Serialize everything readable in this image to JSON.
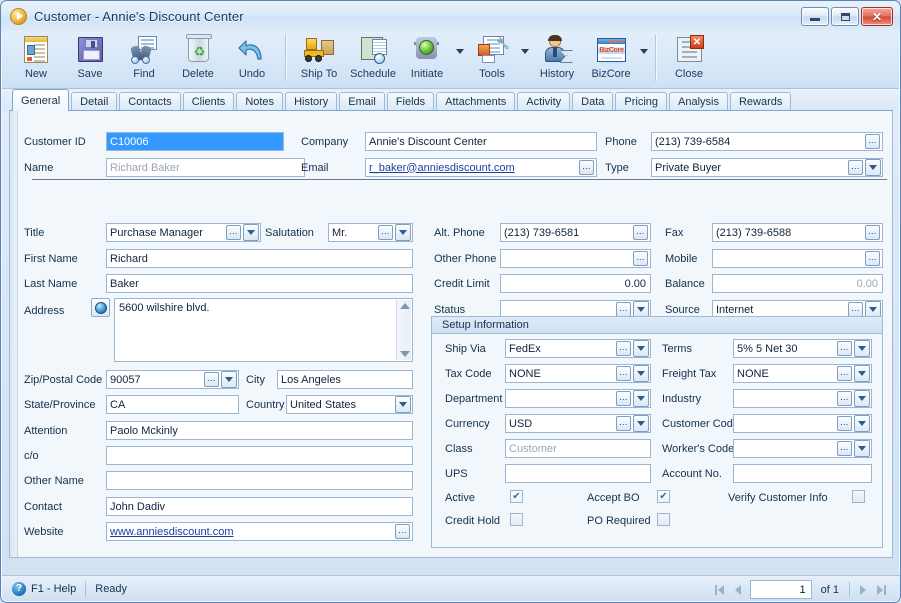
{
  "window": {
    "title": "Customer - Annie's Discount Center",
    "controls": {
      "minimize": "—",
      "maximize": "▫",
      "close": "✕"
    }
  },
  "toolbar": {
    "items": [
      {
        "label": "New",
        "icon": "new-document-icon",
        "dropdown": false
      },
      {
        "label": "Save",
        "icon": "floppy-disk-icon",
        "dropdown": false
      },
      {
        "label": "Find",
        "icon": "binoculars-icon",
        "dropdown": false
      },
      {
        "label": "Delete",
        "icon": "recycle-bin-icon",
        "dropdown": false
      },
      {
        "label": "Undo",
        "icon": "undo-arrow-icon",
        "dropdown": false
      },
      {
        "label": "Ship To",
        "icon": "forklift-icon",
        "dropdown": false
      },
      {
        "label": "Schedule",
        "icon": "calendar-clock-icon",
        "dropdown": false
      },
      {
        "label": "Initiate",
        "icon": "traffic-light-icon",
        "dropdown": true
      },
      {
        "label": "Tools",
        "icon": "tools-icon",
        "dropdown": true
      },
      {
        "label": "History",
        "icon": "person-hourglass-icon",
        "dropdown": false
      },
      {
        "label": "BizCore",
        "icon": "bizcore-window-icon",
        "dropdown": true
      },
      {
        "label": "Close",
        "icon": "close-window-icon",
        "dropdown": false
      }
    ]
  },
  "tabs": [
    {
      "label": "General",
      "active": true
    },
    {
      "label": "Detail",
      "active": false
    },
    {
      "label": "Contacts",
      "active": false
    },
    {
      "label": "Clients",
      "active": false
    },
    {
      "label": "Notes",
      "active": false
    },
    {
      "label": "History",
      "active": false
    },
    {
      "label": "Email",
      "active": false
    },
    {
      "label": "Fields",
      "active": false
    },
    {
      "label": "Attachments",
      "active": false
    },
    {
      "label": "Activity",
      "active": false
    },
    {
      "label": "Data",
      "active": false
    },
    {
      "label": "Pricing",
      "active": false
    },
    {
      "label": "Analysis",
      "active": false
    },
    {
      "label": "Rewards",
      "active": false
    }
  ],
  "header_fields": {
    "customer_id_label": "Customer ID",
    "customer_id_value": "C10006",
    "name_label": "Name",
    "name_value": "Richard Baker",
    "company_label": "Company",
    "company_value": "Annie's Discount Center",
    "email_label": "Email",
    "email_value": "r_baker@anniesdiscount.com",
    "phone_label": "Phone",
    "phone_value": "(213) 739-6584",
    "type_label": "Type",
    "type_value": "Private Buyer"
  },
  "left_column": {
    "title_label": "Title",
    "title_value": "Purchase Manager",
    "salutation_label": "Salutation",
    "salutation_value": "Mr.",
    "first_name_label": "First Name",
    "first_name_value": "Richard",
    "last_name_label": "Last Name",
    "last_name_value": "Baker",
    "address_label": "Address",
    "address_value": "5600 wilshire blvd.",
    "zip_label": "Zip/Postal Code",
    "zip_value": "90057",
    "city_label": "City",
    "city_value": "Los Angeles",
    "state_label": "State/Province",
    "state_value": "CA",
    "country_label": "Country",
    "country_value": "United States",
    "attention_label": "Attention",
    "attention_value": "Paolo Mckinly",
    "co_label": "c/o",
    "co_value": "",
    "other_name_label": "Other Name",
    "other_name_value": "",
    "contact_label": "Contact",
    "contact_value": "John Dadiv",
    "website_label": "Website",
    "website_value": "www.anniesdiscount.com"
  },
  "right_column": {
    "alt_phone_label": "Alt. Phone",
    "alt_phone_value": "(213) 739-6581",
    "fax_label": "Fax",
    "fax_value": "(213) 739-6588",
    "other_phone_label": "Other Phone",
    "other_phone_value": "",
    "mobile_label": "Mobile",
    "mobile_value": "",
    "credit_limit_label": "Credit Limit",
    "credit_limit_value": "0.00",
    "balance_label": "Balance",
    "balance_value": "0.00",
    "status_label": "Status",
    "status_value": "",
    "source_label": "Source",
    "source_value": "Internet"
  },
  "setup": {
    "title": "Setup Information",
    "ship_via_label": "Ship Via",
    "ship_via_value": "FedEx",
    "terms_label": "Terms",
    "terms_value": "5% 5 Net 30",
    "tax_code_label": "Tax Code",
    "tax_code_value": "NONE",
    "freight_tax_label": "Freight Tax",
    "freight_tax_value": "NONE",
    "department_label": "Department",
    "department_value": "",
    "industry_label": "Industry",
    "industry_value": "",
    "currency_label": "Currency",
    "currency_value": "USD",
    "customer_code_label": "Customer Code",
    "customer_code_value": "",
    "class_label": "Class",
    "class_value": "Customer",
    "workers_code_label": "Worker's Code",
    "workers_code_value": "",
    "ups_label": "UPS",
    "ups_value": "",
    "account_no_label": "Account No.",
    "account_no_value": "",
    "active_label": "Active",
    "active_checked": true,
    "accept_bo_label": "Accept BO",
    "accept_bo_checked": true,
    "verify_customer_label": "Verify Customer Info",
    "verify_customer_checked": false,
    "credit_hold_label": "Credit Hold",
    "credit_hold_checked": false,
    "po_required_label": "PO Required",
    "po_required_checked": false
  },
  "statusbar": {
    "help": "F1 - Help",
    "status": "Ready",
    "page_current": "1",
    "page_of": "of 1"
  },
  "colors": {
    "accent": "#2c5d8f",
    "window_border": "#5b83b5",
    "field_border": "#9ab6d4",
    "link": "#1a3fa0",
    "selection": "#3399ff"
  }
}
